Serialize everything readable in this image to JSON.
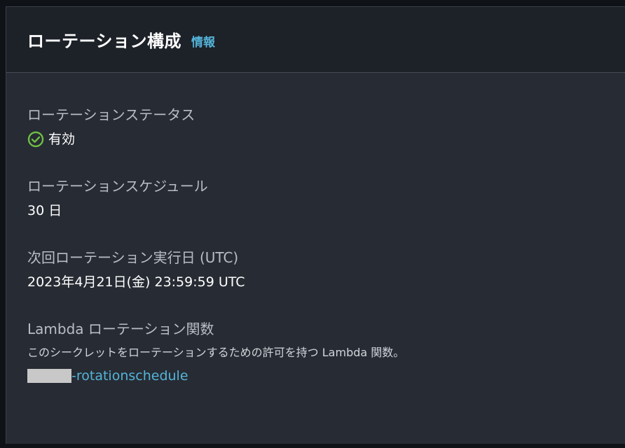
{
  "header": {
    "title": "ローテーション構成",
    "info_label": "情報"
  },
  "fields": {
    "status": {
      "label": "ローテーションステータス",
      "value": "有効",
      "status_color": "#6fbf44"
    },
    "schedule": {
      "label": "ローテーションスケジュール",
      "value": "30 日"
    },
    "next_rotation": {
      "label": "次回ローテーション実行日 (UTC)",
      "value": "2023年4月21日(金) 23:59:59 UTC"
    },
    "lambda": {
      "label": "Lambda ローテーション関数",
      "description": "このシークレットをローテーションするための許可を持つ Lambda 関数。",
      "function_suffix": "-rotationschedule"
    }
  },
  "colors": {
    "link": "#54b4d9",
    "panel_bg": "#272b33",
    "header_bg": "#1d2128"
  }
}
